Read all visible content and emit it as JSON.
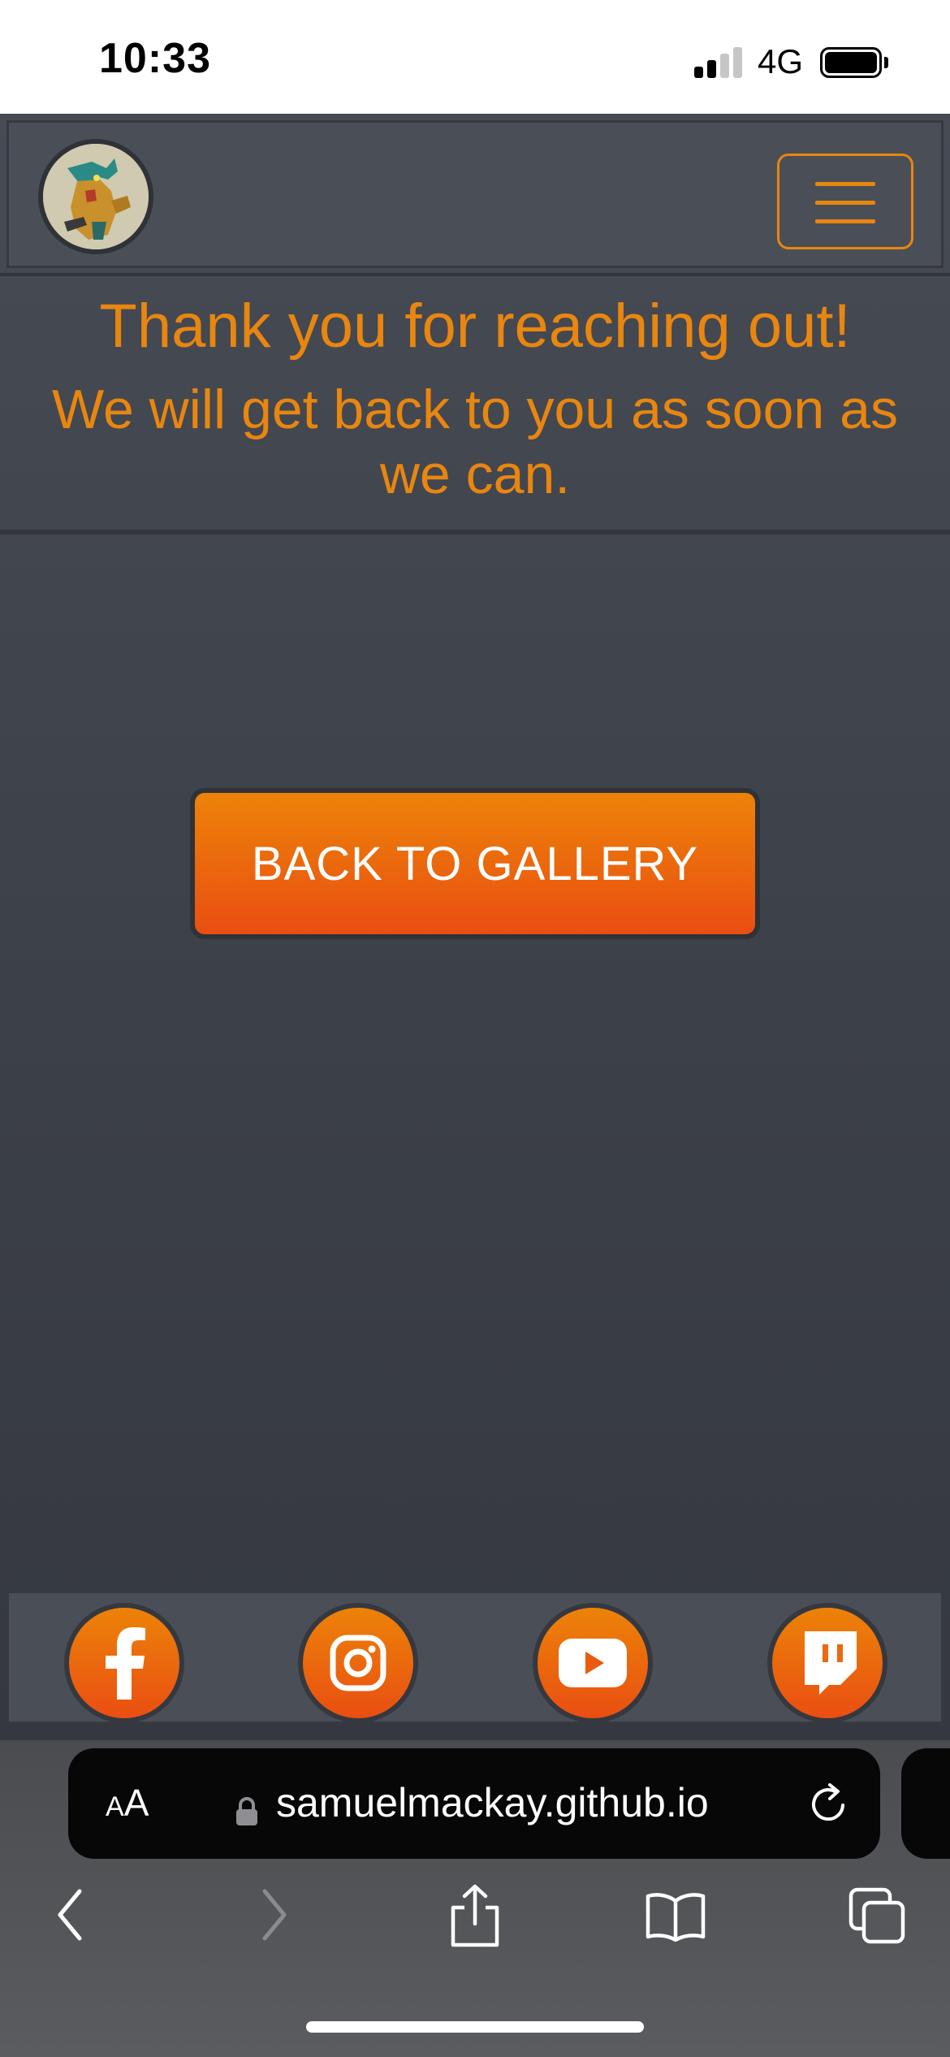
{
  "status_bar": {
    "time": "10:33",
    "network": "4G"
  },
  "colors": {
    "accent": "#e8860f",
    "button_top": "#ec8308",
    "button_bottom": "#ea4e12",
    "navbar_bg": "#4a4f57",
    "page_bg": "#3c4048"
  },
  "navbar": {
    "logo_icon": "dragon-warrior-logo",
    "menu_icon": "hamburger-icon"
  },
  "message": {
    "line1": "Thank you for reaching out!",
    "line2": "We will get back to you as soon as we can."
  },
  "main": {
    "back_button_label": "BACK TO GALLERY"
  },
  "footer": {
    "social_icons": [
      "facebook-icon",
      "instagram-icon",
      "youtube-icon",
      "twitch-icon"
    ]
  },
  "browser": {
    "text_size_label_small": "A",
    "text_size_label_large": "A",
    "url": "samuelmackay.github.io"
  }
}
